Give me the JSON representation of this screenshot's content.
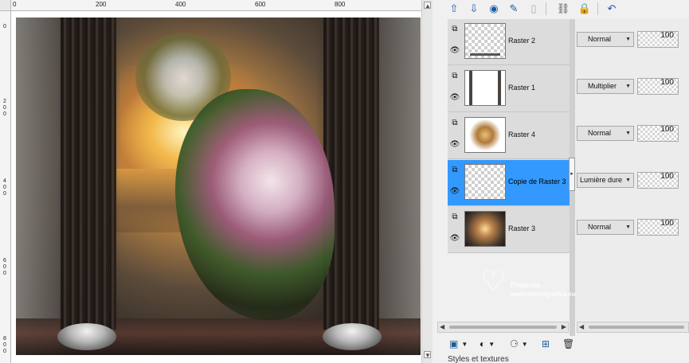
{
  "rulers": {
    "top_labels": [
      "0",
      "200",
      "400",
      "600",
      "800"
    ],
    "left_labels": [
      "0",
      "2",
      "0",
      "0",
      "4",
      "0",
      "0",
      "6",
      "0",
      "0",
      "8",
      "0",
      "0"
    ]
  },
  "layers": [
    {
      "name": "Raster 2",
      "blend": "Normal",
      "opacity": "100",
      "selected": false
    },
    {
      "name": "Raster 1",
      "blend": "Multiplier",
      "opacity": "100",
      "selected": false
    },
    {
      "name": "Raster 4",
      "blend": "Normal",
      "opacity": "100",
      "selected": false
    },
    {
      "name": "Copie de Raster 3",
      "blend": "Lumière dure",
      "opacity": "100",
      "selected": true
    },
    {
      "name": "Raster 3",
      "blend": "Normal",
      "opacity": "100",
      "selected": false
    }
  ],
  "icons": {
    "visibility": "eye-icon",
    "group": "layer-group-icon"
  },
  "bottom_panel_title": "Styles et textures",
  "watermark": {
    "line1": "Pinuccia",
    "line2": "www.maildigrafica.eu"
  },
  "colors": {
    "selection": "#3399ff",
    "accent": "#1a5aa8"
  }
}
